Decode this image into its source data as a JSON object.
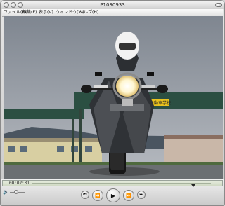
{
  "window": {
    "title": "P1030933"
  },
  "menu": {
    "items": [
      "ファイル(F)",
      "編集(E)",
      "表示(V)",
      "ウィンドウ(W)",
      "ヘルプ(H)"
    ]
  },
  "video": {
    "sign_text": "高知自動車学校"
  },
  "playback": {
    "timecode": "00:02:31",
    "position_fraction": 0.9,
    "volume_fraction": 0.4
  },
  "controls": {
    "skip_back_icon": "skip-back",
    "rewind_icon": "rewind",
    "play_icon": "play",
    "fast_forward_icon": "fast-forward",
    "skip_forward_icon": "skip-forward"
  }
}
